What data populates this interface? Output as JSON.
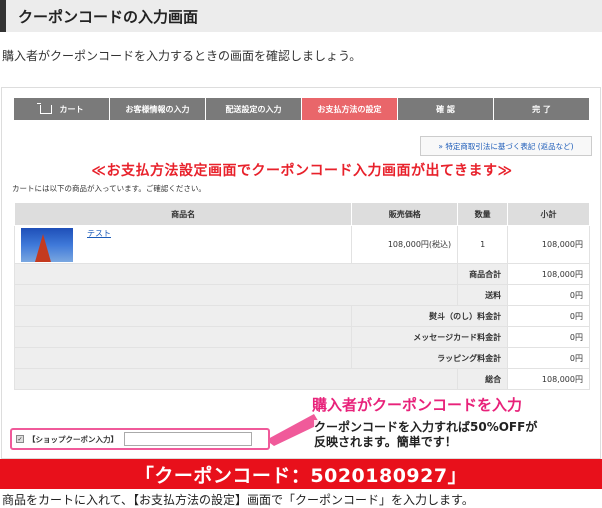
{
  "heading": "クーポンコードの入力画面",
  "intro": "購入者がクーポンコードを入力するときの画面を確認しましょう。",
  "steps": [
    "カート",
    "お客様情報の入力",
    "配送設定の入力",
    "お支払方法の設定",
    "確 認",
    "完 了"
  ],
  "active_step": "お支払方法の設定",
  "legal_link": "» 特定商取引法に基づく表記 (返品など)",
  "banner": "≪お支払方法設定画面でクーポンコード入力画面が出てきます≫",
  "cart_note": "カートには以下の商品が入っています。ご確認ください。",
  "table": {
    "headers": [
      "商品名",
      "販売価格",
      "数量",
      "小計"
    ],
    "item": {
      "name": "テスト",
      "price": "108,000円(税込)",
      "qty": "1",
      "subtotal": "108,000円"
    },
    "summary": [
      {
        "label": "商品合計",
        "value": "108,000円"
      },
      {
        "label": "送料",
        "value": "0円"
      },
      {
        "label": "熨斗（のし）料金計",
        "value": "0円"
      },
      {
        "label": "メッセージカード料金計",
        "value": "0円"
      },
      {
        "label": "ラッピング料金計",
        "value": "0円"
      },
      {
        "label": "総合",
        "value": "108,000円"
      }
    ]
  },
  "coupon": {
    "label": "【ショップクーポン入力】",
    "value": ""
  },
  "callout": {
    "title": "購入者がクーポンコードを入力",
    "line1": "クーポンコードを入力すれば50%OFFが",
    "line2": "反映されます。簡単です！"
  },
  "code_bar": "「クーポンコード：5020180927」",
  "footer": "商品をカートに入れて、【お支払方法の設定】画面で「クーポンコード」を入力します。",
  "colors": {
    "accent_red": "#e8101b",
    "active_step": "#e9666a",
    "callout_pink": "#e8227a"
  }
}
